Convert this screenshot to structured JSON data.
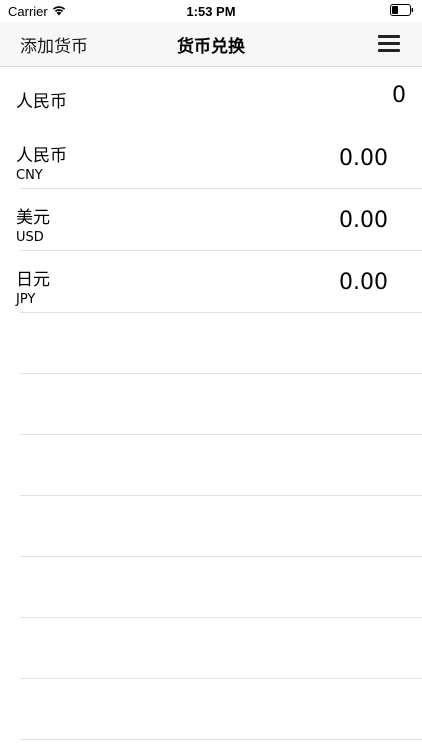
{
  "status_bar": {
    "carrier": "Carrier",
    "time": "1:53 PM"
  },
  "nav": {
    "left_button": "添加货币",
    "title": "货币兑换"
  },
  "base": {
    "label": "人民币",
    "value": "0"
  },
  "currencies": [
    {
      "name": "人民币",
      "code": "CNY",
      "amount": "0.00"
    },
    {
      "name": "美元",
      "code": "USD",
      "amount": "0.00"
    },
    {
      "name": "日元",
      "code": "JPY",
      "amount": "0.00"
    }
  ],
  "icons": {
    "wifi": "wifi-icon",
    "battery": "battery-icon",
    "menu": "hamburger-menu-icon"
  }
}
